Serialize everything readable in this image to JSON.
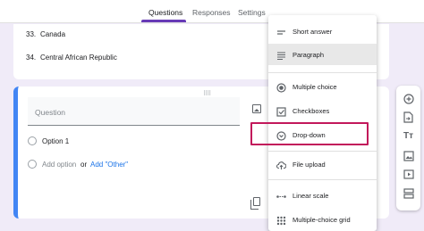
{
  "tabs": [
    {
      "label": "Questions",
      "active": true
    },
    {
      "label": "Responses",
      "active": false
    },
    {
      "label": "Settings",
      "active": false
    }
  ],
  "countries": [
    {
      "number": "33.",
      "name": "Canada"
    },
    {
      "number": "34.",
      "name": "Central African Republic"
    }
  ],
  "question": {
    "placeholder": "Question",
    "option_1": "Option 1",
    "add_option": "Add option",
    "or": "or",
    "add_other": "Add \"Other\""
  },
  "menu": {
    "items": [
      {
        "label": "Short answer",
        "icon": "short-answer-icon"
      },
      {
        "label": "Paragraph",
        "icon": "paragraph-icon",
        "selected": true
      },
      {
        "label": "Multiple choice",
        "icon": "radio-button-icon"
      },
      {
        "label": "Checkboxes",
        "icon": "checkbox-icon"
      },
      {
        "label": "Drop-down",
        "icon": "dropdown-circle-icon",
        "highlighted": true
      },
      {
        "label": "File upload",
        "icon": "cloud-upload-icon"
      },
      {
        "label": "Linear scale",
        "icon": "linear-scale-icon"
      },
      {
        "label": "Multiple-choice grid",
        "icon": "grid-icon"
      }
    ]
  },
  "side_toolbar": {
    "icons": [
      "add-circle-icon",
      "import-icon",
      "title-text-icon",
      "image-icon",
      "video-icon",
      "section-icon"
    ]
  },
  "colors": {
    "accent": "#673ab7",
    "card_border": "#4285f4",
    "highlight": "#c2185b",
    "link": "#1a73e8",
    "background": "#f0ebf8"
  }
}
